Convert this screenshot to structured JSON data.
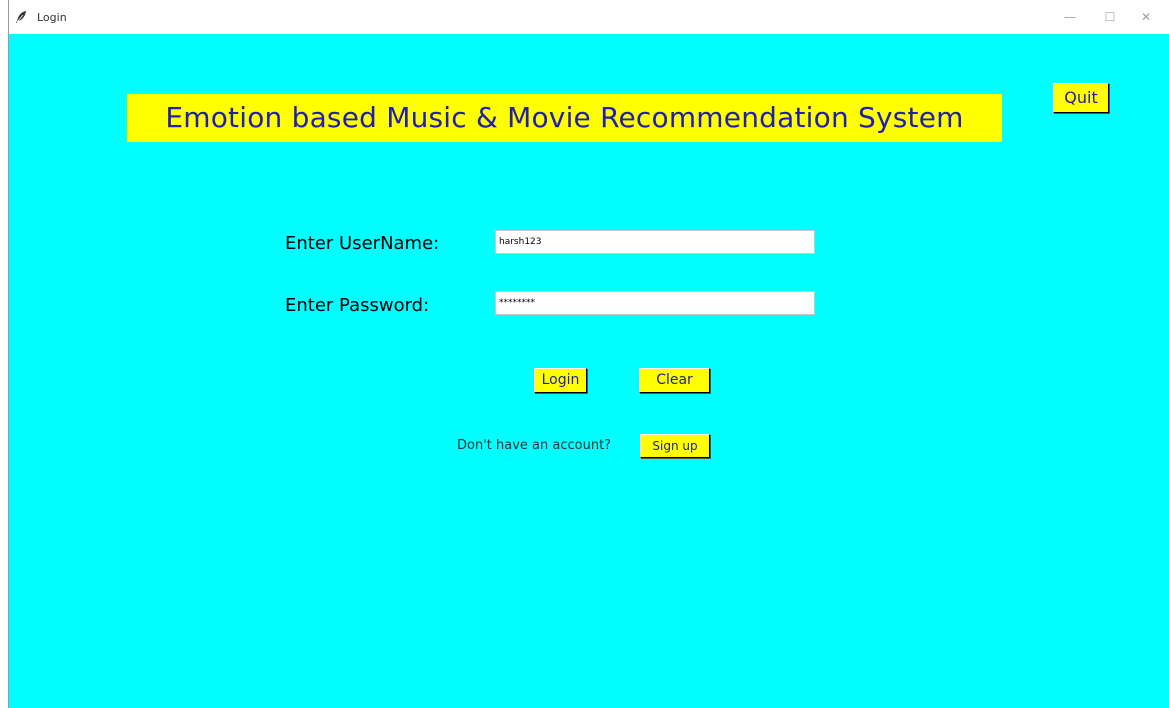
{
  "window": {
    "title": "Login",
    "controls": {
      "minimize": "—",
      "maximize": "☐",
      "close": "✕"
    }
  },
  "header": {
    "title": "Emotion based Music & Movie Recommendation System",
    "quit_label": "Quit"
  },
  "form": {
    "username_label": "Enter UserName:",
    "username_value": "harsh123",
    "password_label": "Enter Password:",
    "password_value": "********",
    "login_label": "Login",
    "clear_label": "Clear"
  },
  "signup": {
    "prompt": "Don't have an account?",
    "button_label": "Sign up"
  },
  "colors": {
    "background": "#00ffff",
    "button": "#ffff00",
    "banner_text": "#1f1fb0"
  },
  "icons": {
    "app": "feather-icon"
  }
}
